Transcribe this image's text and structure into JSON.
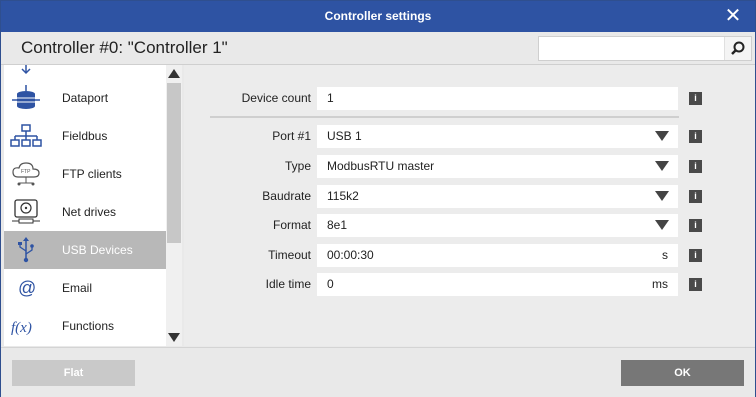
{
  "window": {
    "title": "Controller settings"
  },
  "header": {
    "controller_title": "Controller #0: \"Controller 1\"",
    "search_value": ""
  },
  "sidebar": {
    "items": [
      {
        "label": "",
        "icon": "dataport-top-icon"
      },
      {
        "label": "Dataport",
        "icon": "database-icon"
      },
      {
        "label": "Fieldbus",
        "icon": "network-tree-icon"
      },
      {
        "label": "FTP clients",
        "icon": "ftp-cloud-icon"
      },
      {
        "label": "Net drives",
        "icon": "net-drive-icon"
      },
      {
        "label": "USB Devices",
        "icon": "usb-icon",
        "selected": true
      },
      {
        "label": "Email",
        "icon": "at-sign-icon"
      },
      {
        "label": "Functions",
        "icon": "function-icon"
      }
    ]
  },
  "form": {
    "device_count": {
      "label": "Device count",
      "value": "1"
    },
    "port": {
      "label": "Port #1",
      "value": "USB 1"
    },
    "type": {
      "label": "Type",
      "value": "ModbusRTU master"
    },
    "baudrate": {
      "label": "Baudrate",
      "value": "115k2"
    },
    "format": {
      "label": "Format",
      "value": "8e1"
    },
    "timeout": {
      "label": "Timeout",
      "value": "00:00:30",
      "unit": "s"
    },
    "idle_time": {
      "label": "Idle time",
      "value": "0",
      "unit": "ms"
    },
    "info_glyph": "i"
  },
  "footer": {
    "flat_label": "Flat",
    "ok_label": "OK"
  },
  "colors": {
    "titlebar": "#2e53a3",
    "selected_item": "#b8b8b8",
    "ok_button": "#777777",
    "icon_blue": "#2e53a3"
  }
}
